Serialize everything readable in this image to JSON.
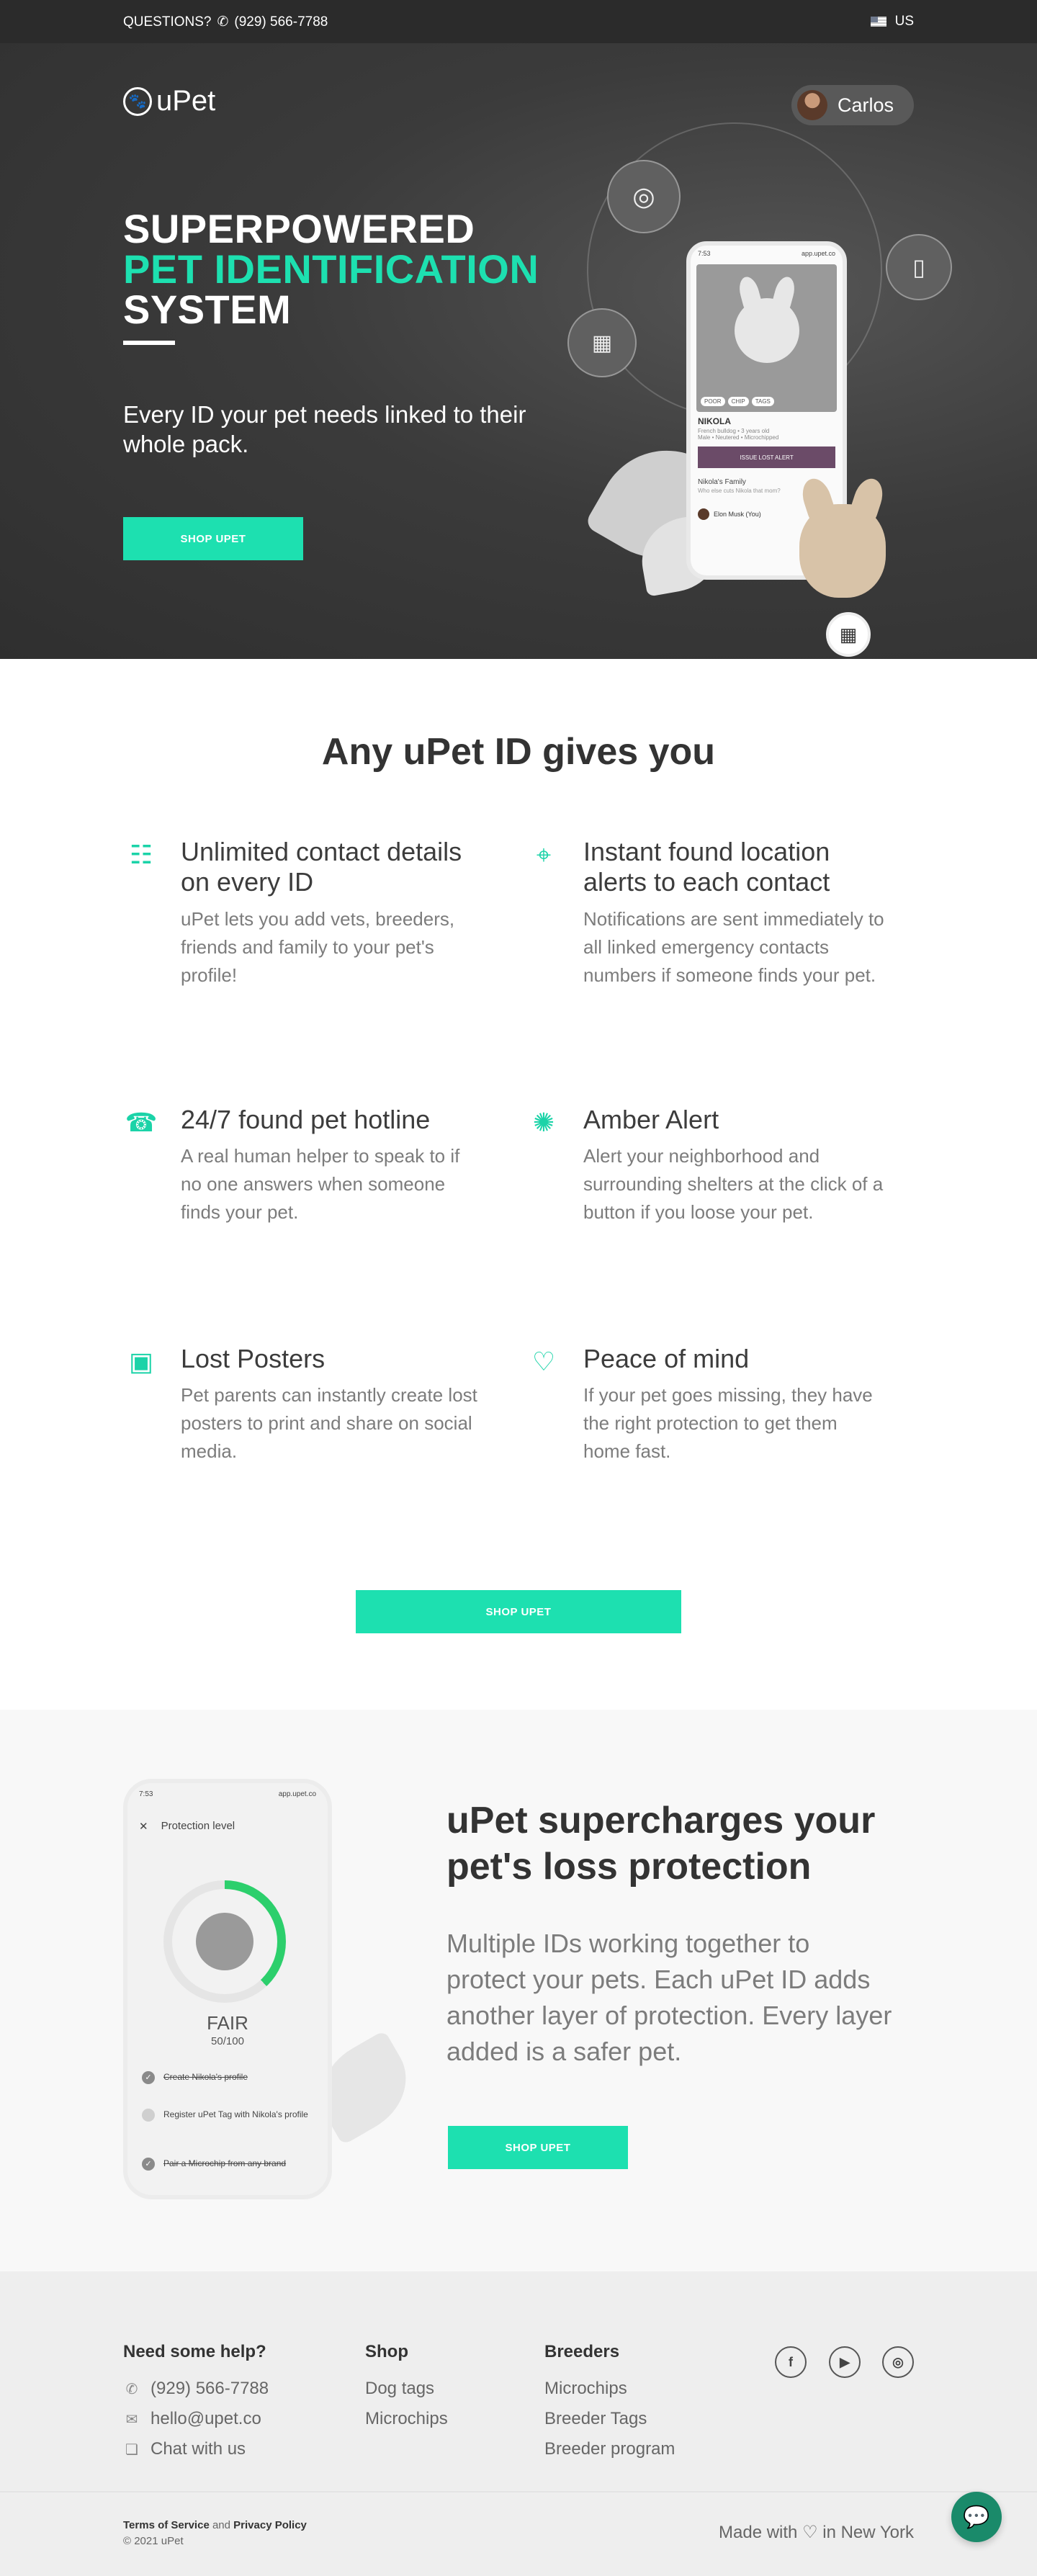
{
  "topbar": {
    "questions": "QUESTIONS?",
    "phone": "(929) 566-7788",
    "country": "US"
  },
  "header": {
    "logo": "uPet",
    "user_name": "Carlos"
  },
  "hero": {
    "title_line1": "SUPERPOWERED",
    "title_line2": "PET IDENTIFICATION",
    "title_line3": "SYSTEM",
    "subtitle": "Every ID your pet needs linked to their whole pack.",
    "cta": "SHOP UPET",
    "phone": {
      "time": "7:53",
      "url": "app.upet.co",
      "chips": [
        "POOR",
        "CHIP",
        "TAGS"
      ],
      "pet_name": "NIKOLA",
      "pet_line1": "French bulldog • 3 years old",
      "pet_line2": "Male • Neutered • Microchipped",
      "alert_button": "ISSUE LOST ALERT",
      "family_title": "Nikola's Family",
      "family_sub": "Who else cuts Nikola that mom?",
      "member": "Elon Musk (You)"
    }
  },
  "features": {
    "title": "Any uPet ID gives you",
    "items": [
      {
        "icon": "contacts-icon",
        "title": "Unlimited contact details on every ID",
        "text": "uPet lets you add vets, breeders, friends and family to your pet's profile!"
      },
      {
        "icon": "location-pin-icon",
        "title": "Instant found location alerts to each contact",
        "text": "Notifications are sent immediately to all linked emergency contacts numbers if someone finds your pet."
      },
      {
        "icon": "hotline-agent-icon",
        "title": "24/7 found pet hotline",
        "text": "A real human helper to speak to if no one answers when someone finds your pet."
      },
      {
        "icon": "alarm-light-icon",
        "title": "Amber Alert",
        "text": "Alert your neighborhood and surrounding shelters at the click of a button if you loose your pet."
      },
      {
        "icon": "poster-icon",
        "title": "Lost Posters",
        "text": "Pet parents can instantly create lost posters to print and share on social media."
      },
      {
        "icon": "hand-heart-icon",
        "title": "Peace of mind",
        "text": "If your pet goes missing, they have the right protection to get them home fast."
      }
    ],
    "cta": "SHOP UPET"
  },
  "protection": {
    "title": "uPet supercharges your pet's loss protection",
    "text": "Multiple IDs working together to protect your pets. Each uPet ID adds another layer of protection. Every layer added is a safer pet.",
    "cta": "SHOP UPET",
    "phone": {
      "time": "7:53",
      "url": "app.upet.co",
      "header": "Protection level",
      "level": "FAIR",
      "score": "50/100",
      "score_fraction": 0.5,
      "tasks": [
        {
          "text": "Create Nikola's profile",
          "done": true
        },
        {
          "text": "Register uPet Tag with Nikola's profile",
          "done": false
        },
        {
          "text": "Pair a Microchip from any brand",
          "done": true
        }
      ]
    }
  },
  "footer": {
    "help": {
      "title": "Need some help?",
      "phone": "(929) 566-7788",
      "email": "hello@upet.co",
      "chat": "Chat with us"
    },
    "shop": {
      "title": "Shop",
      "items": [
        "Dog tags",
        "Microchips"
      ]
    },
    "breeders": {
      "title": "Breeders",
      "items": [
        "Microchips",
        "Breeder Tags",
        "Breeder program"
      ]
    },
    "social": [
      "facebook-icon",
      "youtube-icon",
      "instagram-icon"
    ],
    "terms": "Terms of Service",
    "and": "and",
    "privacy": "Privacy Policy",
    "copyright": "© 2021 uPet",
    "made_with": "Made with ♡ in New York"
  },
  "colors": {
    "accent": "#1de0b0",
    "dark": "#2b2b2b",
    "footer_bg": "#eeeeee"
  }
}
